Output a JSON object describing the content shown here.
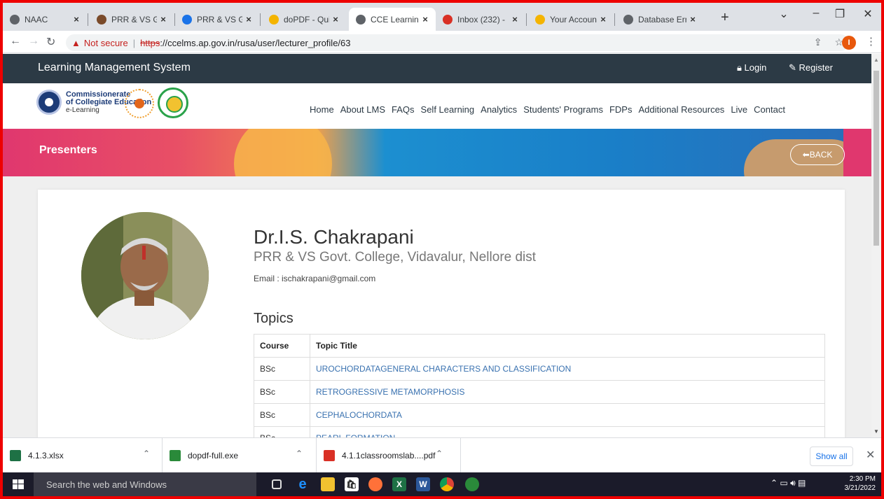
{
  "browser": {
    "tabs": [
      {
        "label": "NAAC",
        "favicon": "globe-icon",
        "color": "#5f6368"
      },
      {
        "label": "PRR & VS Gov",
        "favicon": "college-icon",
        "color": "#7a4a2a"
      },
      {
        "label": "PRR & VS Gov",
        "favicon": "college-icon",
        "color": "#1a73e8"
      },
      {
        "label": "doPDF - Quic",
        "favicon": "dopdf-icon",
        "color": "#f4b400"
      },
      {
        "label": "CCE Learning",
        "favicon": "globe-icon",
        "color": "#5f6368",
        "active": true
      },
      {
        "label": "Inbox (232) -",
        "favicon": "gmail-icon",
        "color": "#d93025"
      },
      {
        "label": "Your Account",
        "favicon": "yahoo-mail-icon",
        "color": "#f4b400"
      },
      {
        "label": "Database Erro",
        "favicon": "globe-icon",
        "color": "#5f6368"
      }
    ],
    "close_glyph": "×",
    "new_tab_glyph": "+",
    "address": {
      "warning": "Not secure",
      "scheme": "https",
      "url_rest": "://ccelms.ap.gov.in/rusa/user/lecturer_profile/63"
    },
    "profile_initial": "I"
  },
  "site": {
    "top_title": "Learning Management System",
    "login": "Login",
    "register": "Register",
    "logo": {
      "line1": "Commissionerate",
      "line2": "of Collegiate Education",
      "line3": "e-Learning"
    },
    "nav": [
      "Home",
      "About LMS",
      "FAQs",
      "Self Learning",
      "Analytics",
      "Students' Programs",
      "FDPs",
      "Additional Resources",
      "Live",
      "Contact"
    ],
    "banner_title": "Presenters",
    "back_label": "BACK"
  },
  "profile": {
    "name": "Dr.I.S. Chakrapani",
    "college": "PRR & VS Govt. College, Vidavalur, Nellore dist",
    "email": "Email : ischakrapani@gmail.com",
    "topics_heading": "Topics",
    "table": {
      "headers": [
        "Course",
        "Topic Title"
      ],
      "rows": [
        [
          "BSc",
          "UROCHORDATAGENERAL CHARACTERS AND CLASSIFICATION"
        ],
        [
          "BSc",
          "RETROGRESSIVE METAMORPHOSIS"
        ],
        [
          "BSc",
          "CEPHALOCHORDATA"
        ],
        [
          "BSc",
          "PEARL FORMATION"
        ]
      ]
    }
  },
  "downloads": {
    "items": [
      {
        "name": "4.1.3.xlsx",
        "icon": "excel-file-icon",
        "color": "#1e7145"
      },
      {
        "name": "dopdf-full.exe",
        "icon": "dopdf-exe-icon",
        "color": "#2a8a3a"
      },
      {
        "name": "4.1.1classroomslab....pdf",
        "icon": "pdf-file-icon",
        "color": "#d93025"
      }
    ],
    "show_all": "Show all"
  },
  "taskbar": {
    "search_placeholder": "Search the web and Windows",
    "time": "2:30 PM",
    "date": "3/21/2022"
  }
}
